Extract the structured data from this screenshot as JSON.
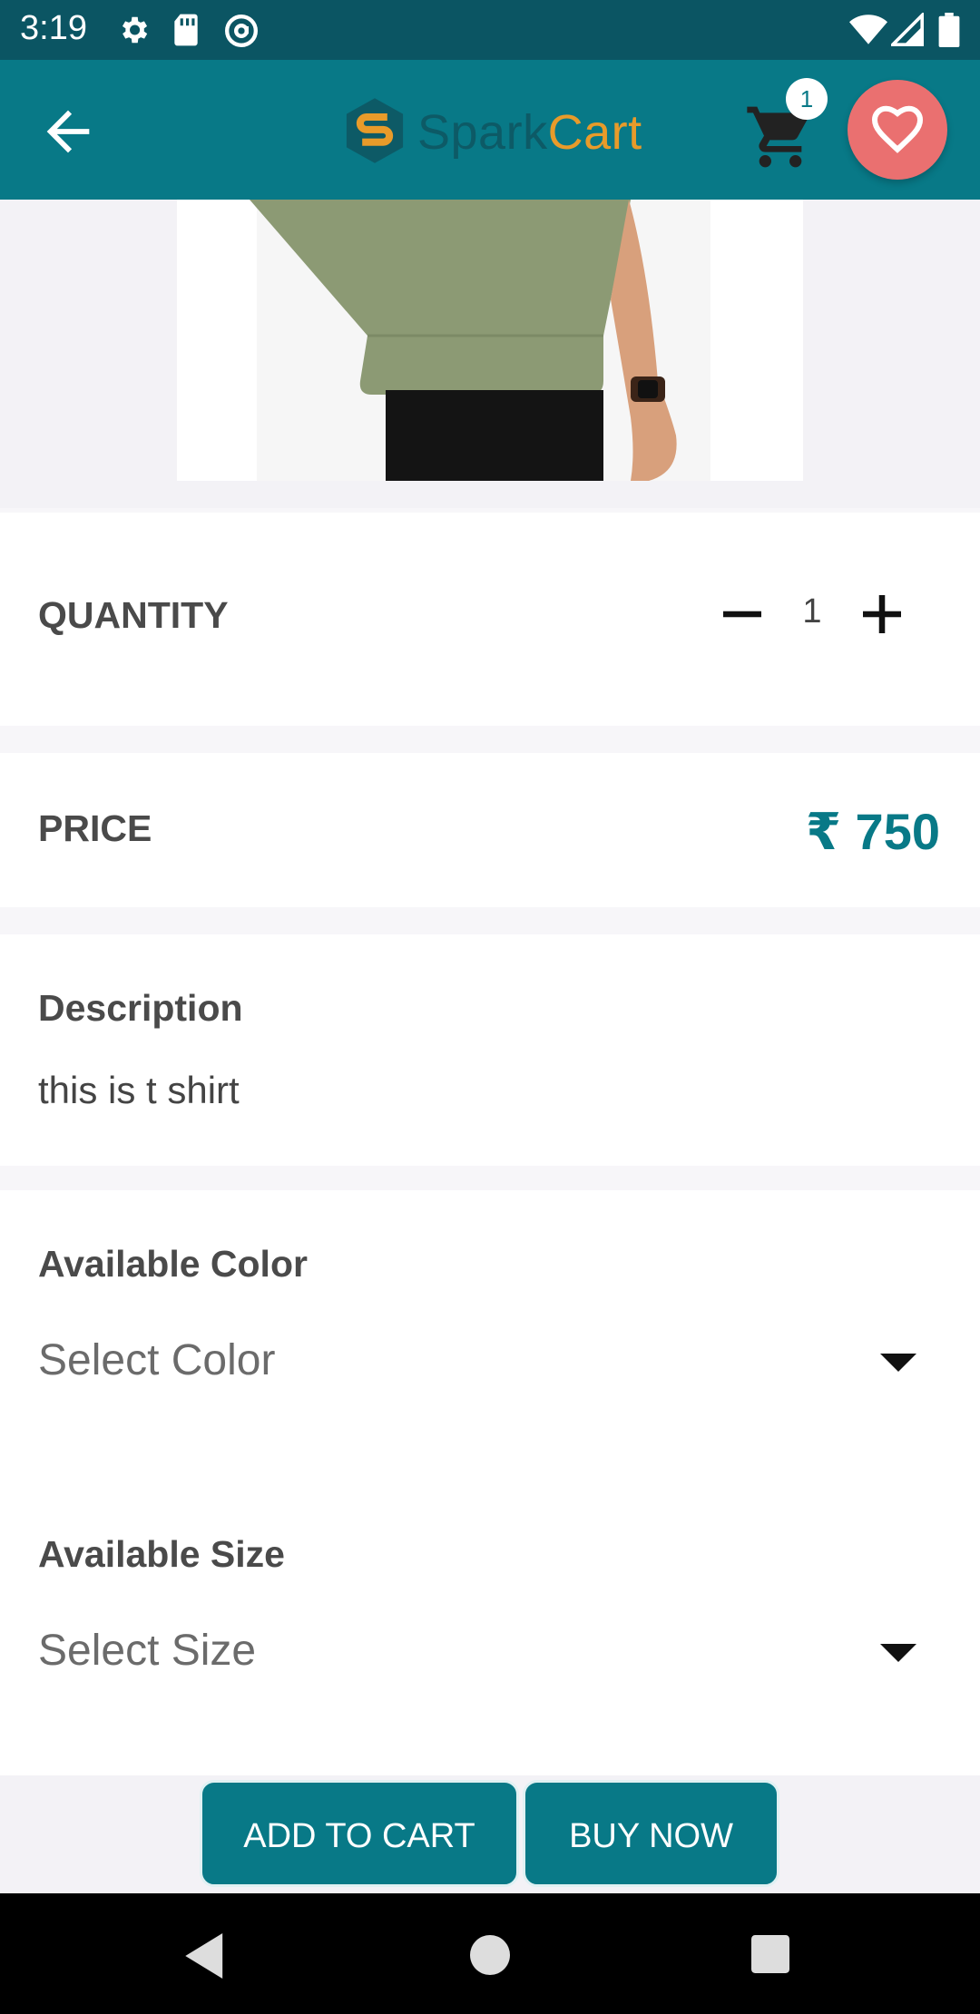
{
  "status_bar": {
    "time": "3:19",
    "icons": [
      "gear-icon",
      "sd-card-icon",
      "at-sign-icon",
      "wifi-icon",
      "signal-icon",
      "battery-icon"
    ]
  },
  "app_bar": {
    "logo_spark": "Spark",
    "logo_cart": "Cart",
    "cart_count": "1",
    "icons": [
      "arrow-back-icon",
      "logo-icon",
      "shopping-cart-icon",
      "heart-icon"
    ]
  },
  "product": {
    "image_alt": "t shirt"
  },
  "quantity": {
    "label": "QUANTITY",
    "value": "1"
  },
  "price": {
    "label": "PRICE",
    "value": "₹ 750"
  },
  "description": {
    "label": "Description",
    "text": "this is t shirt"
  },
  "color": {
    "label": "Available Color",
    "placeholder": "Select Color"
  },
  "size": {
    "label": "Available Size",
    "placeholder": "Select Size"
  },
  "actions": {
    "add_to_cart": "ADD TO CART",
    "buy_now": "BUY NOW"
  },
  "colors": {
    "status_bar": "#0b5563",
    "app_bar": "#087987",
    "accent": "#087987",
    "favorite": "#ea7070",
    "logo_cart": "#e89b2a"
  }
}
